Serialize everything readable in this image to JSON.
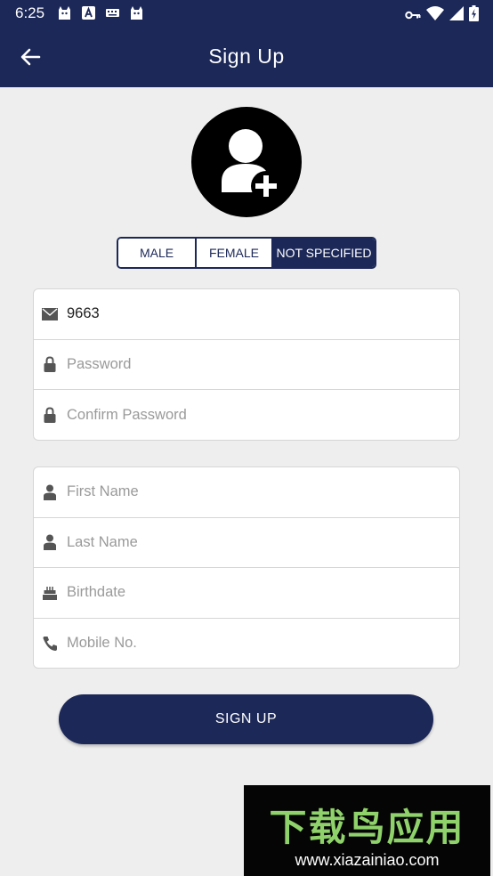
{
  "status": {
    "time": "6:25",
    "left_icons": [
      "cat-notification-icon",
      "a-notification-icon",
      "keyboard-icon",
      "cat-notification-icon"
    ],
    "right_icons": [
      "vpn-key-icon",
      "wifi-icon",
      "cell-signal-icon",
      "battery-charging-icon"
    ]
  },
  "appbar": {
    "title": "Sign Up",
    "back_icon": "arrow-left-icon"
  },
  "avatar": {
    "icon": "add-user-icon"
  },
  "gender": {
    "options": [
      "MALE",
      "FEMALE",
      "NOT SPECIFIED"
    ],
    "selected": "NOT SPECIFIED"
  },
  "account_fields": {
    "email": {
      "value": "9663",
      "placeholder": "",
      "icon": "envelope-icon"
    },
    "password": {
      "value": "",
      "placeholder": "Password",
      "icon": "lock-icon"
    },
    "confirm_password": {
      "value": "",
      "placeholder": "Confirm Password",
      "icon": "lock-icon"
    }
  },
  "profile_fields": {
    "first_name": {
      "value": "",
      "placeholder": "First Name",
      "icon": "person-icon"
    },
    "last_name": {
      "value": "",
      "placeholder": "Last Name",
      "icon": "person-icon"
    },
    "birthdate": {
      "value": "",
      "placeholder": "Birthdate",
      "icon": "cake-icon"
    },
    "mobile": {
      "value": "",
      "placeholder": "Mobile No.",
      "icon": "phone-icon"
    }
  },
  "signup_button": "SIGN UP",
  "watermark": {
    "title": "下载鸟应用",
    "url": "www.xiazainiao.com"
  },
  "colors": {
    "primary": "#1c2858",
    "background": "#eeeeee",
    "placeholder": "#9a9a9a",
    "watermark_green": "#8fd16a"
  }
}
